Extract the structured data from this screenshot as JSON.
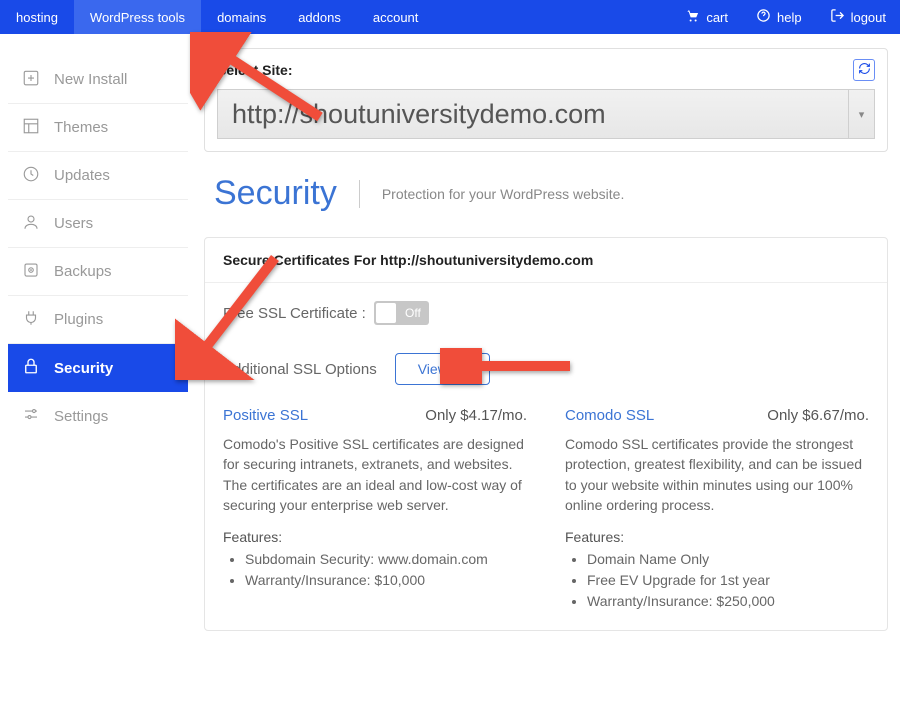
{
  "topnav": {
    "items": [
      "hosting",
      "WordPress tools",
      "domains",
      "addons",
      "account"
    ],
    "activeIndex": 1
  },
  "toputils": {
    "cart": "cart",
    "help": "help",
    "logout": "logout"
  },
  "sidebar": {
    "items": [
      {
        "label": "New Install"
      },
      {
        "label": "Themes"
      },
      {
        "label": "Updates"
      },
      {
        "label": "Users"
      },
      {
        "label": "Backups"
      },
      {
        "label": "Plugins"
      },
      {
        "label": "Security"
      },
      {
        "label": "Settings"
      }
    ],
    "activeIndex": 6
  },
  "siteSelect": {
    "label": "Select Site:",
    "value": "http://shoutuniversitydemo.com"
  },
  "page": {
    "title": "Security",
    "subtitle": "Protection for your WordPress website."
  },
  "panel": {
    "heading": "Secure Certificates For http://shoutuniversitydemo.com",
    "freeSslLabel": "Free SSL Certificate :",
    "toggleState": "Off",
    "additionalLabel": "Additional SSL Options",
    "viewAll": "View All"
  },
  "products": [
    {
      "name": "Positive SSL",
      "price": "Only $4.17/mo.",
      "desc": "Comodo's Positive SSL certificates are designed for securing intranets, extranets, and websites. The certificates are an ideal and low-cost way of securing your enterprise web server.",
      "featHead": "Features:",
      "features": [
        "Subdomain Security: www.domain.com",
        "Warranty/Insurance: $10,000"
      ]
    },
    {
      "name": "Comodo SSL",
      "price": "Only $6.67/mo.",
      "desc": "Comodo SSL certificates provide the strongest protection, greatest flexibility, and can be issued to your website within minutes using our 100% online ordering process.",
      "featHead": "Features:",
      "features": [
        "Domain Name Only",
        "Free EV Upgrade for 1st year",
        "Warranty/Insurance: $250,000"
      ]
    }
  ]
}
